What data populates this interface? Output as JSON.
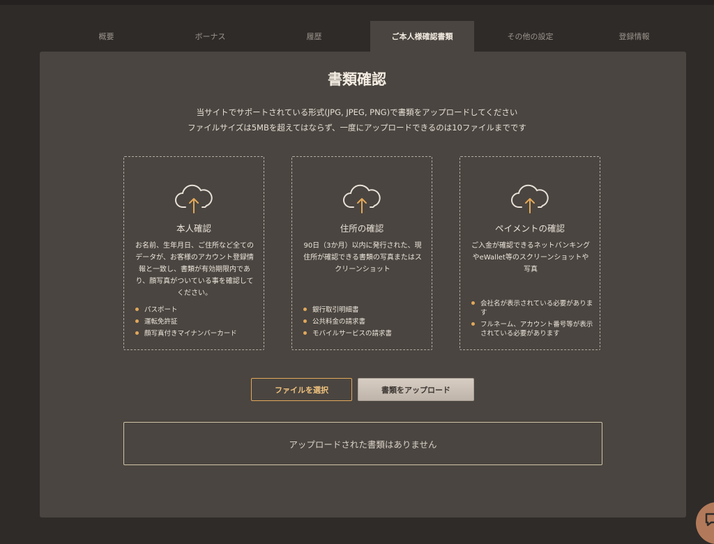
{
  "tabs": [
    {
      "label": "概要",
      "active": false
    },
    {
      "label": "ボーナス",
      "active": false
    },
    {
      "label": "履歴",
      "active": false
    },
    {
      "label": "ご本人様確認書類",
      "active": true
    },
    {
      "label": "その他の設定",
      "active": false
    },
    {
      "label": "登録情報",
      "active": false
    }
  ],
  "page": {
    "title": "書類確認",
    "subtitle_1": "当サイトでサポートされている形式(JPG, JPEG, PNG)で書類をアップロードしてください",
    "subtitle_2": "ファイルサイズは5MBを超えてはならず、一度にアップロードできるのは10ファイルまでです"
  },
  "cards": [
    {
      "icon": "cloud-upload-icon",
      "title": "本人確認",
      "description": "お名前、生年月日、ご住所など全てのデータが、お客様のアカウント登録情報と一致し、書類が有効期限内であり、顔写真がついている事を確認してください。",
      "items": [
        "パスポート",
        "運転免許証",
        "顔写真付きマイナンバーカード"
      ]
    },
    {
      "icon": "cloud-upload-icon",
      "title": "住所の確認",
      "description": "90日（3か月）以内に発行された、現住所が確認できる書類の写真またはスクリーンショット",
      "items": [
        "銀行取引明細書",
        "公共料金の請求書",
        "モバイルサービスの請求書"
      ]
    },
    {
      "icon": "cloud-upload-icon",
      "title": "ペイメントの確認",
      "description": "ご入金が確認できるネットバンキングやeWallet等のスクリーンショットや写真",
      "items": [
        "会社名が表示されている必要があります",
        "フルネーム、アカウント番号等が表示されている必要があります"
      ]
    }
  ],
  "buttons": {
    "select_file": "ファイルを選択",
    "upload": "書類をアップロード"
  },
  "empty_state": "アップロードされた書類はありません",
  "colors": {
    "accent": "#e3a85a",
    "panel": "#4a4540",
    "background": "#2f2b29"
  }
}
